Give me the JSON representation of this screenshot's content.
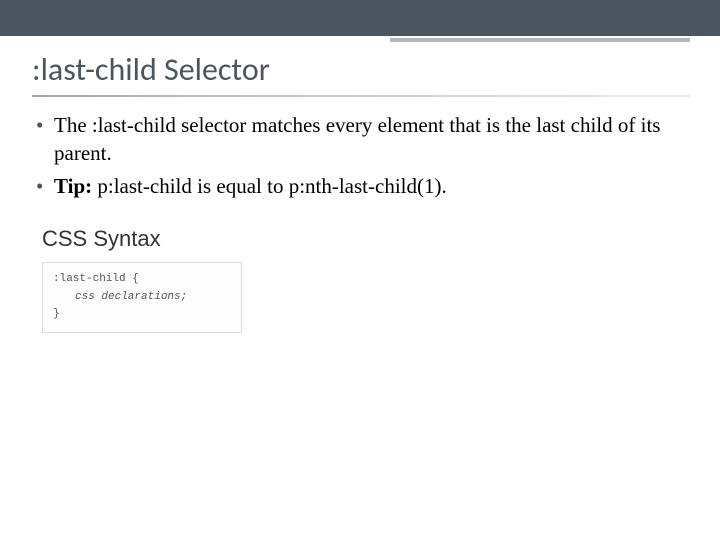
{
  "slide": {
    "title": ":last-child Selector",
    "bullets": [
      {
        "text": "The :last-child selector matches every element that is the last child of its parent."
      },
      {
        "tip_label": "Tip:",
        "text": " p:last-child is equal to p:nth-last-child(1)."
      }
    ],
    "syntax": {
      "heading": "CSS Syntax",
      "code": {
        "line1": ":last-child {",
        "line2": "css declarations;",
        "line3": "}"
      }
    }
  }
}
